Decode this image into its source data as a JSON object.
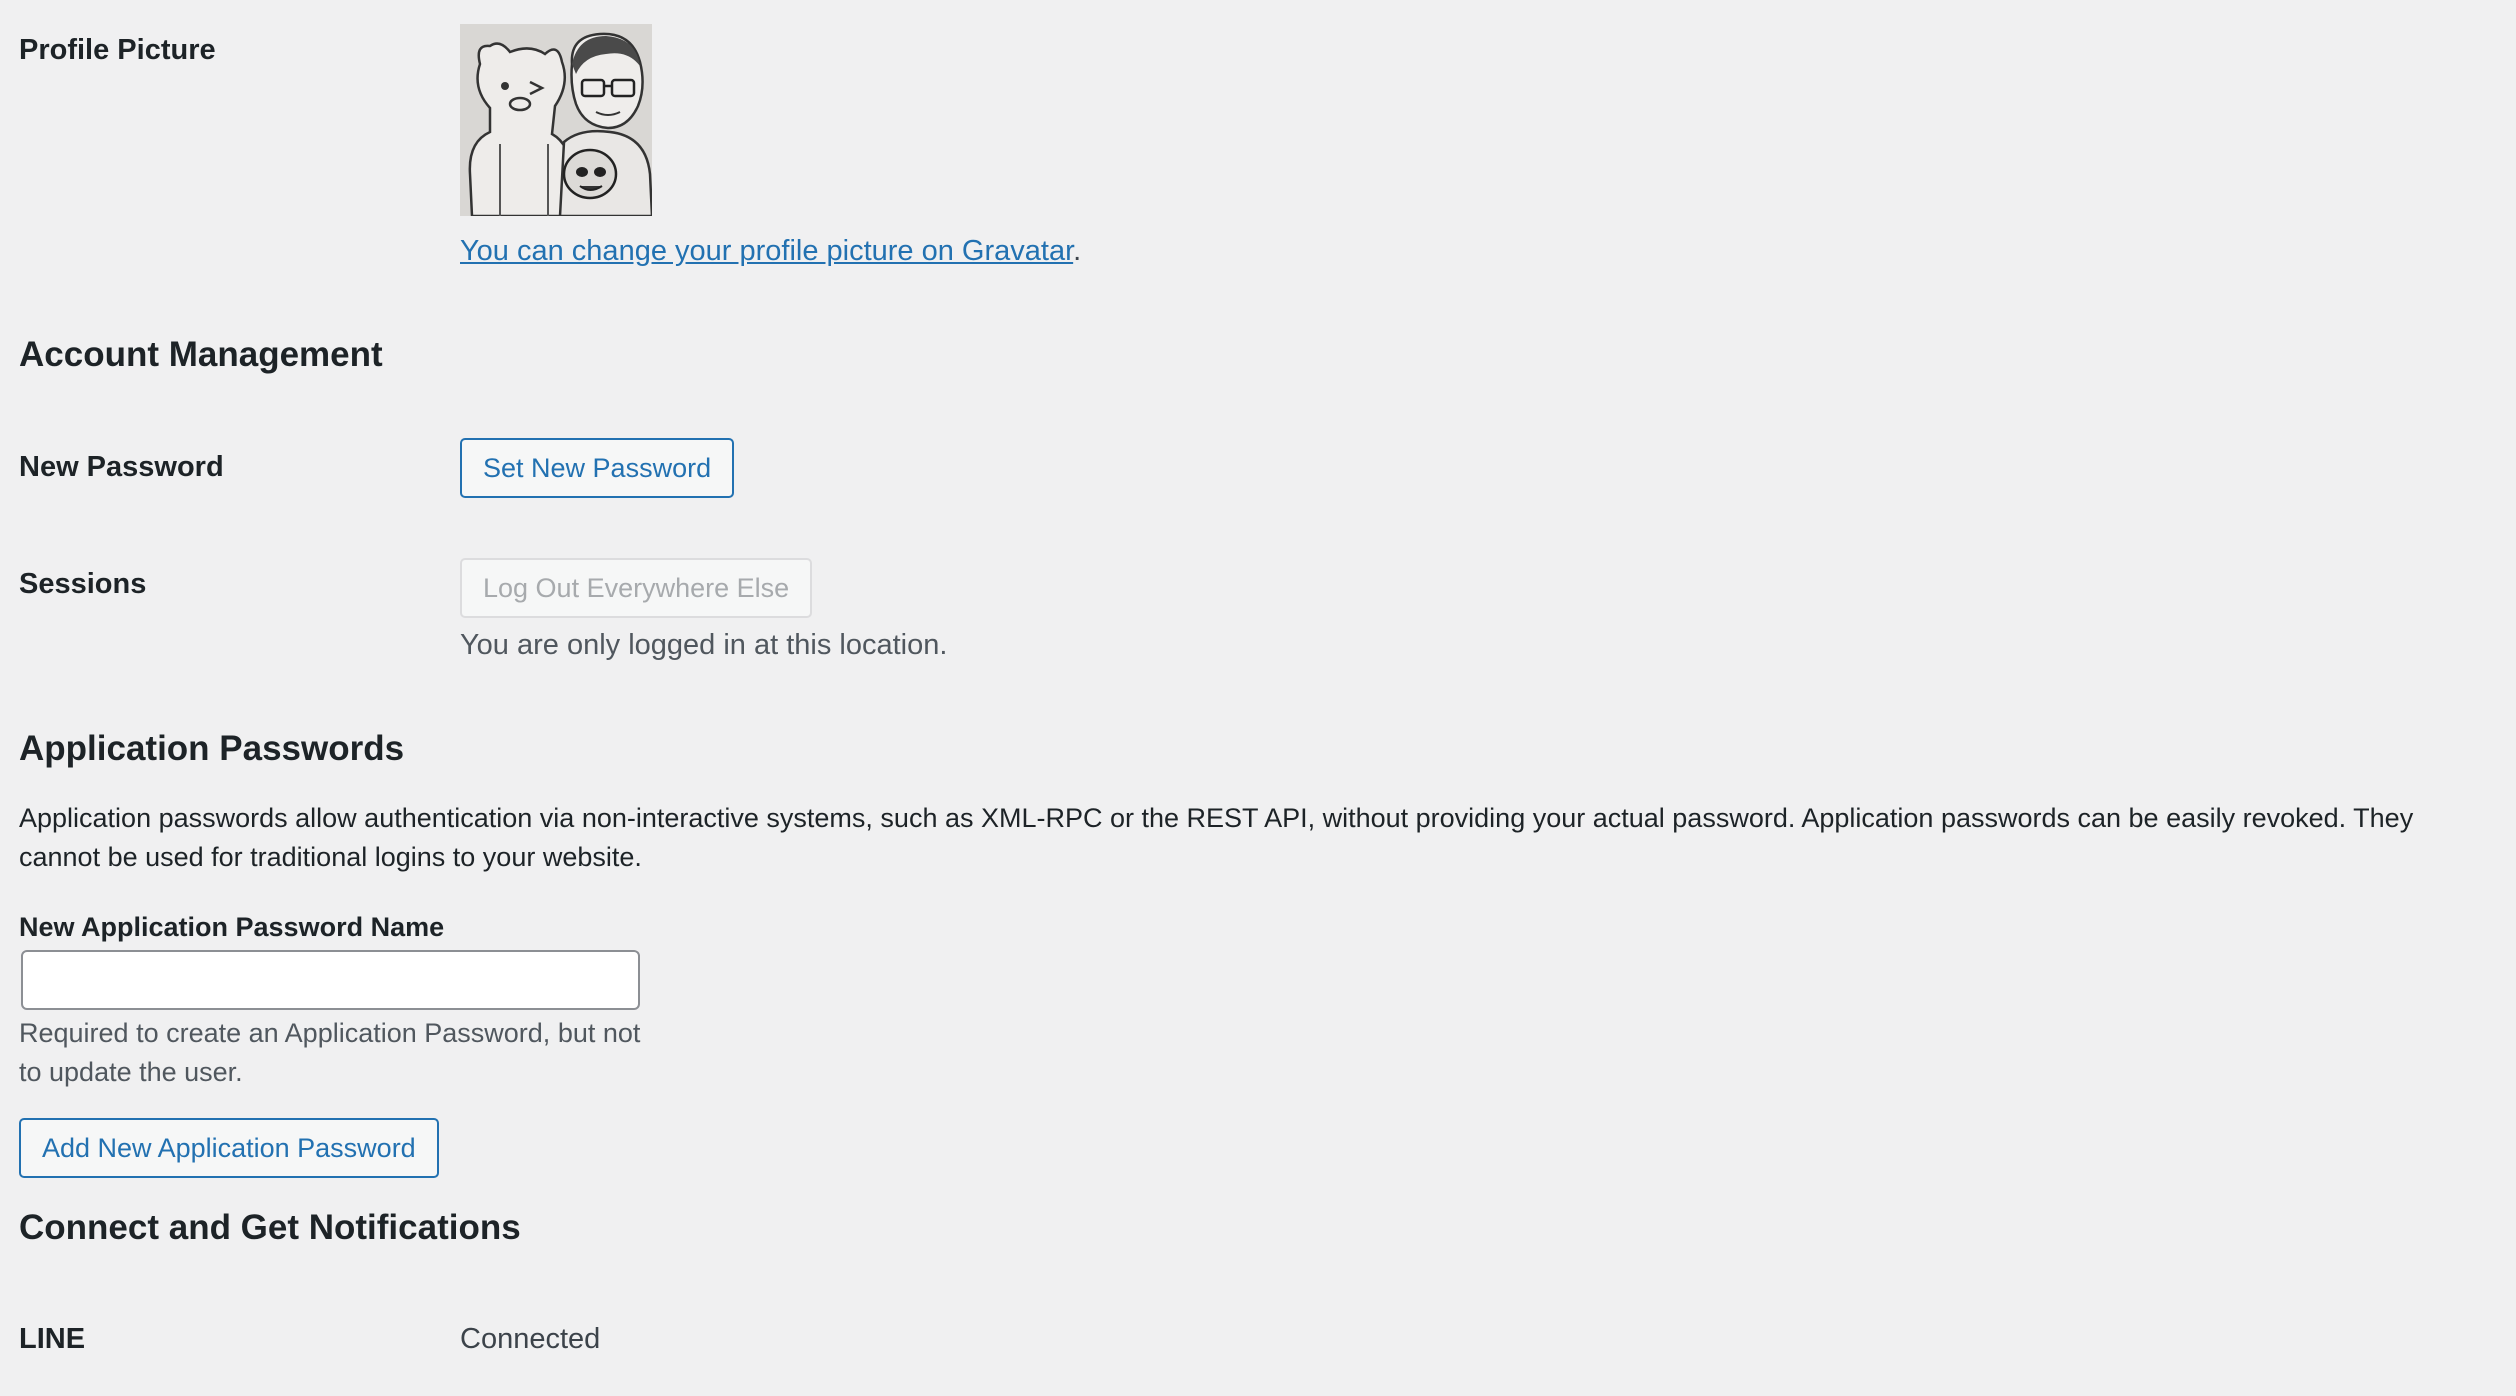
{
  "profile_picture": {
    "label": "Profile Picture",
    "avatar_alt": "avatar",
    "gravatar_link_text": "You can change your profile picture on Gravatar",
    "gravatar_suffix": "."
  },
  "account_management": {
    "title": "Account Management",
    "new_password": {
      "label": "New Password",
      "button": "Set New Password"
    },
    "sessions": {
      "label": "Sessions",
      "button": "Log Out Everywhere Else",
      "note": "You are only logged in at this location."
    }
  },
  "application_passwords": {
    "title": "Application Passwords",
    "description": "Application passwords allow authentication via non-interactive systems, such as XML-RPC or the REST API, without providing your actual password. Application passwords can be easily revoked. They cannot be used for traditional logins to your website.",
    "name_label": "New Application Password Name",
    "name_value": "",
    "name_placeholder": "",
    "help": "Required to create an Application Password, but not to update the user.",
    "add_button": "Add New Application Password"
  },
  "connect_notifications": {
    "title": "Connect and Get Notifications",
    "line": {
      "label": "LINE",
      "status": "Connected"
    }
  }
}
